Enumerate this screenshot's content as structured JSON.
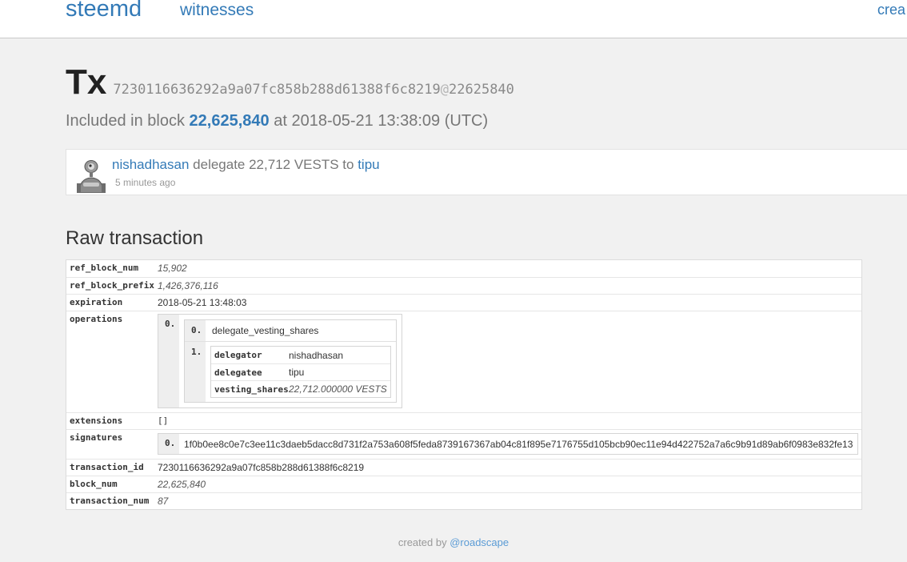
{
  "nav": {
    "brand": "steemd",
    "witnesses": "witnesses",
    "create": "crea"
  },
  "tx": {
    "label": "Tx",
    "hash": "7230116636292a9a07fc858b288d61388f6c8219",
    "at": "@",
    "block_ref": "22625840",
    "included_prefix": "Included in block",
    "included_block": "22,625,840",
    "included_suffix": "at 2018-05-21 13:38:09 (UTC)"
  },
  "op_card": {
    "from": "nishadhasan",
    "action": "delegate 22,712 VESTS to",
    "to": "tipu",
    "time": "5 minutes ago",
    "avatar_icon": "robot-avatar-icon"
  },
  "raw": {
    "heading": "Raw transaction",
    "ref_block_num": {
      "key": "ref_block_num",
      "value": "15,902"
    },
    "ref_block_prefix": {
      "key": "ref_block_prefix",
      "value": "1,426,376,116"
    },
    "expiration": {
      "key": "expiration",
      "value": "2018-05-21 13:48:03"
    },
    "operations": {
      "key": "operations",
      "outer_index": "0.",
      "items": [
        {
          "index": "0.",
          "value": "delegate_vesting_shares"
        }
      ],
      "params_index": "1.",
      "params": [
        {
          "key": "delegator",
          "value": "nishadhasan"
        },
        {
          "key": "delegatee",
          "value": "tipu"
        },
        {
          "key": "vesting_shares",
          "value": "22,712.000000 VESTS"
        }
      ]
    },
    "extensions": {
      "key": "extensions",
      "value": "[]"
    },
    "signatures": {
      "key": "signatures",
      "index": "0.",
      "value": "1f0b0ee8c0e7c3ee11c3daeb5dacc8d731f2a753a608f5feda8739167367ab04c81f895e7176755d105bcb90ec11e94d422752a7a6c9b91d89ab6f0983e832fe13"
    },
    "transaction_id": {
      "key": "transaction_id",
      "value": "7230116636292a9a07fc858b288d61388f6c8219"
    },
    "block_num": {
      "key": "block_num",
      "value": "22,625,840"
    },
    "transaction_num": {
      "key": "transaction_num",
      "value": "87"
    }
  },
  "footer": {
    "prefix": "created by",
    "author": "@roadscape"
  }
}
